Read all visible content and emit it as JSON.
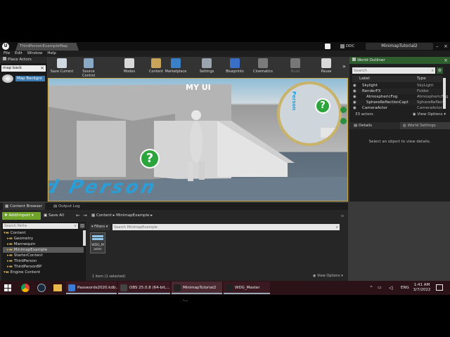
{
  "window": {
    "map_tab": "ThirdPersonExampleMap",
    "source_control_chip": "DDC",
    "project_name": "MinimapTutorial2"
  },
  "menu": [
    "File",
    "Edit",
    "Window",
    "Help"
  ],
  "place_actors": {
    "header": "Place Actors",
    "search_value": "map back",
    "result": "Map Backgro"
  },
  "toolbar": [
    {
      "label": "Save Current",
      "icon": "save-icon"
    },
    {
      "label": "Source Control",
      "icon": "source-control-icon"
    },
    {
      "label": "Modes",
      "icon": "modes-icon"
    },
    {
      "label": "Content",
      "icon": "content-icon"
    },
    {
      "label": "Marketplace",
      "icon": "marketplace-icon"
    },
    {
      "label": "Settings",
      "icon": "settings-icon"
    },
    {
      "label": "Blueprints",
      "icon": "blueprints-icon"
    },
    {
      "label": "Cinematics",
      "icon": "cinematics-icon"
    },
    {
      "label": "Build",
      "icon": "build-icon"
    },
    {
      "label": "Pause",
      "icon": "pause-icon"
    }
  ],
  "viewport": {
    "hud_title": "MY UI",
    "floor_text": "d Person",
    "minimap_text": "Person"
  },
  "world_outliner": {
    "tab": "World Outliner",
    "search_placeholder": "Search",
    "col_label": "Label",
    "col_type": "Type",
    "rows": [
      {
        "label": "Skylight",
        "type": "SkyLight"
      },
      {
        "label": "RenderFX",
        "type": "Folder"
      },
      {
        "label": "AtmosphericFog",
        "type": "AtmosphericFog"
      },
      {
        "label": "SphereReflectionCapt",
        "type": "SphereReflect"
      },
      {
        "label": "CameraActor",
        "type": "CameraActor"
      }
    ],
    "actor_count": "33 actors",
    "view_options": "View Options"
  },
  "details": {
    "tab": "Details",
    "tab2": "World Settings",
    "empty_text": "Select an object to view details."
  },
  "content_browser": {
    "tab": "Content Browser",
    "tab2": "Output Log",
    "add_import": "Add/Import",
    "save_all": "Save All",
    "path": [
      "Content",
      "MinimapExample"
    ],
    "search_paths_placeholder": "Search Paths",
    "filters": "Filters",
    "search_placeholder": "Search MinimapExample",
    "tree": [
      {
        "label": "Content",
        "level": 0
      },
      {
        "label": "Geometry",
        "level": 1
      },
      {
        "label": "Mannequin",
        "level": 1
      },
      {
        "label": "MinimapExample",
        "level": 1,
        "selected": true
      },
      {
        "label": "StarterContent",
        "level": 1
      },
      {
        "label": "ThirdPerson",
        "level": 1
      },
      {
        "label": "ThirdPersonBP",
        "level": 1
      },
      {
        "label": "Engine Content",
        "level": 0
      }
    ],
    "asset_label": "WDG_Master",
    "status": "1 item (1 selected)",
    "view_options": "View Options"
  },
  "taskbar": {
    "apps": [
      {
        "label": "Passwords2020.kdb...",
        "color": "#3a7bd5"
      },
      {
        "label": "OBS 25.0.8 (64-bit,...",
        "color": "#444"
      },
      {
        "label": "MinimapTutorial2 -...",
        "color": "#222"
      },
      {
        "label": "WDG_Master",
        "color": "#222"
      }
    ],
    "lang": "ENG",
    "time": "1:41 AM",
    "date": "3/7/2022"
  },
  "colors": {
    "ue_bg": "#3a3a3a",
    "panel_dark": "#1a1a1a",
    "accent_green": "#6fa32a",
    "viewport_border": "#c8a64a",
    "taskbar": "#2a1216"
  }
}
